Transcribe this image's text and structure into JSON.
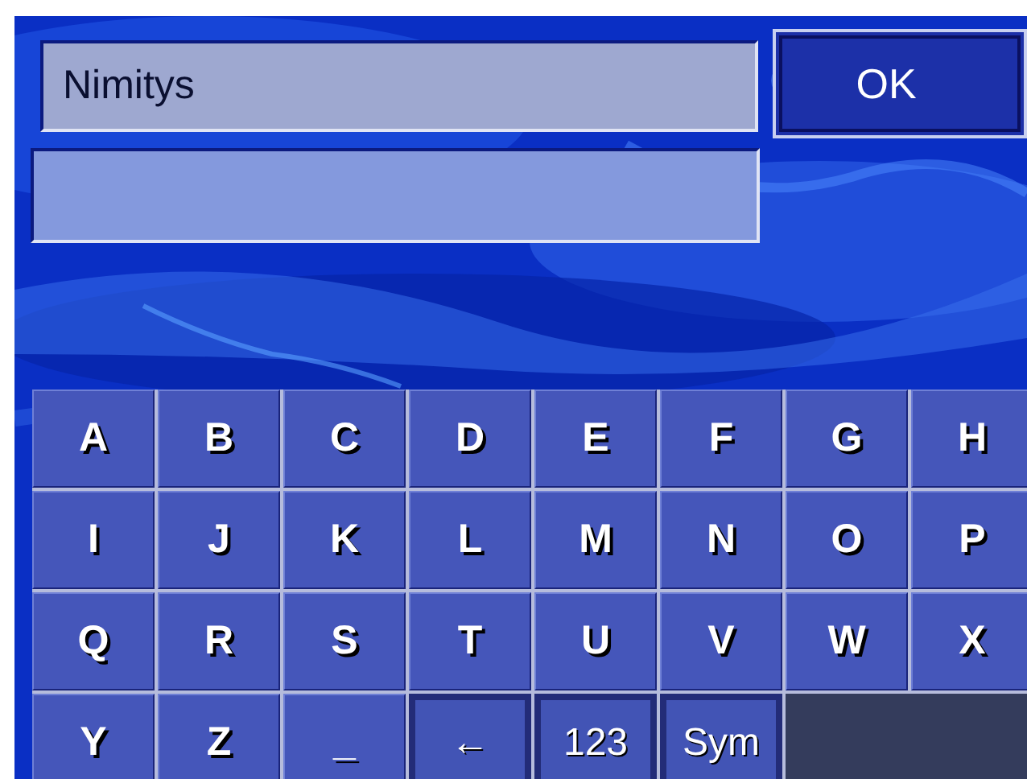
{
  "title_field": {
    "text": "Nimitys"
  },
  "ok_button": {
    "label": "OK"
  },
  "keys": [
    {
      "label": "A",
      "kind": "letter"
    },
    {
      "label": "B",
      "kind": "letter"
    },
    {
      "label": "C",
      "kind": "letter"
    },
    {
      "label": "D",
      "kind": "letter"
    },
    {
      "label": "E",
      "kind": "letter"
    },
    {
      "label": "F",
      "kind": "letter"
    },
    {
      "label": "G",
      "kind": "letter"
    },
    {
      "label": "H",
      "kind": "letter"
    },
    {
      "label": "I",
      "kind": "letter"
    },
    {
      "label": "J",
      "kind": "letter"
    },
    {
      "label": "K",
      "kind": "letter"
    },
    {
      "label": "L",
      "kind": "letter"
    },
    {
      "label": "M",
      "kind": "letter"
    },
    {
      "label": "N",
      "kind": "letter"
    },
    {
      "label": "O",
      "kind": "letter"
    },
    {
      "label": "P",
      "kind": "letter"
    },
    {
      "label": "Q",
      "kind": "letter"
    },
    {
      "label": "R",
      "kind": "letter"
    },
    {
      "label": "S",
      "kind": "letter"
    },
    {
      "label": "T",
      "kind": "letter"
    },
    {
      "label": "U",
      "kind": "letter"
    },
    {
      "label": "V",
      "kind": "letter"
    },
    {
      "label": "W",
      "kind": "letter"
    },
    {
      "label": "X",
      "kind": "letter"
    },
    {
      "label": "Y",
      "kind": "letter"
    },
    {
      "label": "Z",
      "kind": "letter"
    },
    {
      "label": "_",
      "kind": "letter"
    },
    {
      "label": "←",
      "kind": "function"
    },
    {
      "label": "123",
      "kind": "function"
    },
    {
      "label": "Sym",
      "kind": "function"
    }
  ]
}
